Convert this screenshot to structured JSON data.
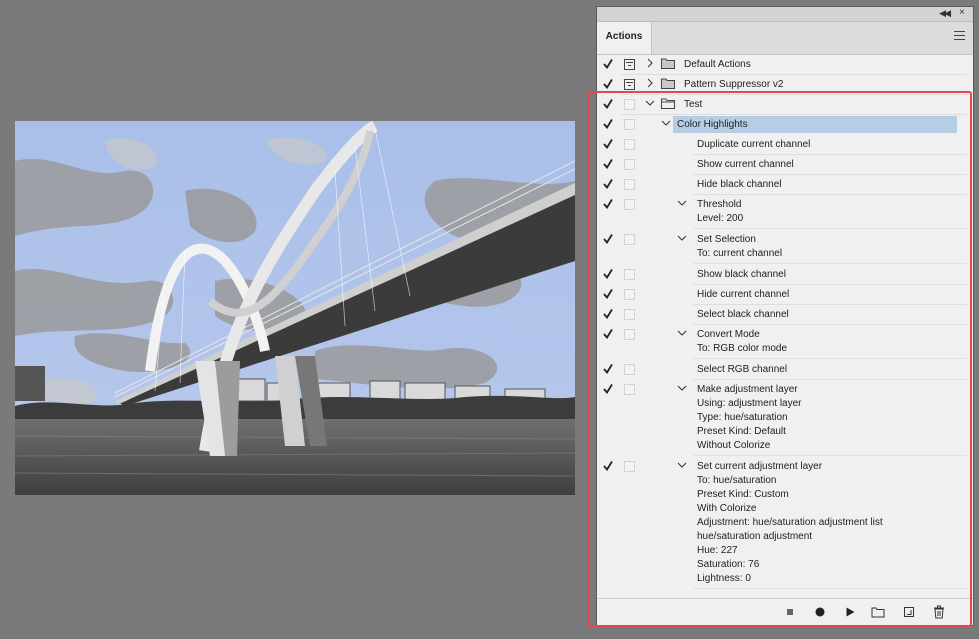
{
  "panel": {
    "tab_label": "Actions",
    "icons": {
      "collapse": "double-chevron-left-icon",
      "close": "close-icon",
      "menu": "hamburger-menu-icon"
    }
  },
  "actions": [
    {
      "label": "Default Actions"
    },
    {
      "label": "Pattern Suppressor v2"
    },
    {
      "label": "Test"
    },
    {
      "label": "Color Highlights"
    }
  ],
  "steps": [
    {
      "label": "Duplicate current channel"
    },
    {
      "label": "Show current channel"
    },
    {
      "label": "Hide black channel"
    },
    {
      "label": "Threshold",
      "params": [
        "Level: 200"
      ]
    },
    {
      "label": "Set Selection",
      "params": [
        "To: current channel"
      ]
    },
    {
      "label": "Show black channel"
    },
    {
      "label": "Hide current channel"
    },
    {
      "label": "Select black channel"
    },
    {
      "label": "Convert Mode",
      "params": [
        "To: RGB color mode"
      ]
    },
    {
      "label": "Select RGB channel"
    },
    {
      "label": "Make adjustment layer",
      "params": [
        "Using: adjustment layer",
        "Type: hue/saturation",
        "Preset Kind: Default",
        "Without Colorize"
      ]
    },
    {
      "label": "Set current adjustment layer",
      "params": [
        "To: hue/saturation",
        "Preset Kind: Custom",
        "With Colorize",
        "Adjustment: hue/saturation adjustment list",
        "hue/saturation adjustment",
        "Hue: 227",
        "Saturation: 76",
        "Lightness: 0"
      ]
    }
  ],
  "footer": {
    "buttons": [
      "stop-icon",
      "record-icon",
      "play-icon",
      "new-set-folder-icon",
      "new-action-icon",
      "delete-trash-icon"
    ]
  },
  "colors": {
    "selection": "#b6cde6",
    "highlight_border": "#e0484a"
  }
}
